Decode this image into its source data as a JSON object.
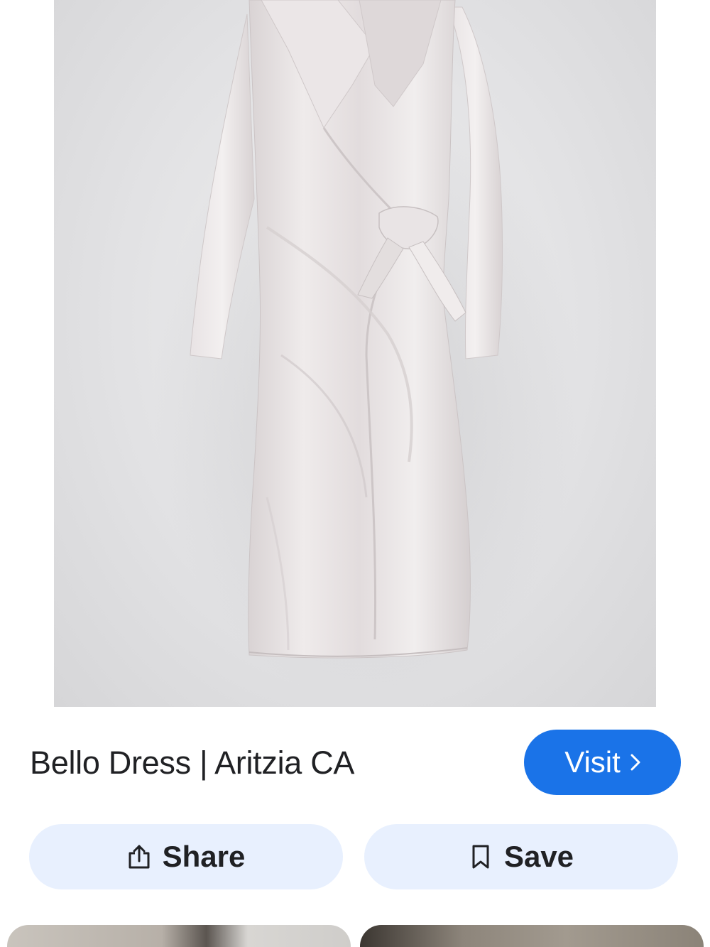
{
  "result": {
    "title": "Bello Dress | Aritzia CA",
    "image_subject": "dress-photo"
  },
  "actions": {
    "visit_label": "Visit",
    "share_label": "Share",
    "save_label": "Save"
  },
  "icons": {
    "visit": "chevron-right-icon",
    "share": "share-icon",
    "save": "bookmark-icon"
  },
  "colors": {
    "accent": "#1a73e8",
    "action_background": "#e8f0fe",
    "text": "#202124",
    "image_background": "#e2e2e4",
    "dress": "#e6e1e2"
  },
  "related_results": [
    {
      "name": "related-result-1"
    },
    {
      "name": "related-result-2"
    }
  ]
}
